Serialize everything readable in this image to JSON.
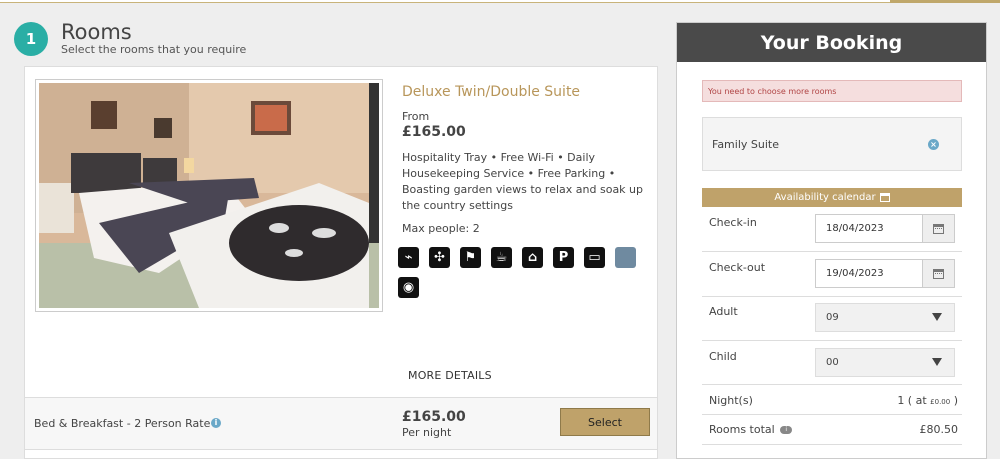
{
  "step": {
    "number": "1",
    "title": "Rooms",
    "subtitle": "Select the rooms that you require"
  },
  "room": {
    "name": "Deluxe Twin/Double Suite",
    "from_label": "From",
    "from_price": "£165.00",
    "amenities": "Hospitality Tray • Free Wi-Fi • Daily Housekeeping Service • Free Parking • Boasting garden views to relax and soak up the country settings",
    "max_people": "Max people: 2",
    "facility_icons": [
      {
        "name": "hairdryer-plug-icon",
        "glyph": "⌁"
      },
      {
        "name": "fan-icon",
        "glyph": "✣"
      },
      {
        "name": "hairdryer-icon",
        "glyph": "⚑"
      },
      {
        "name": "kettle-icon",
        "glyph": "☕"
      },
      {
        "name": "house-icon",
        "glyph": "⌂"
      },
      {
        "name": "parking-icon",
        "glyph": "P"
      },
      {
        "name": "tv-icon",
        "glyph": "▭"
      },
      {
        "name": "garden-view-icon",
        "glyph": ""
      },
      {
        "name": "wifi-icon",
        "glyph": "◉"
      }
    ],
    "more_details": "MORE DETAILS"
  },
  "rate": {
    "name": "Bed & Breakfast - 2 Person Rate",
    "price": "£165.00",
    "per": "Per night",
    "select_label": "Select"
  },
  "booking": {
    "title": "Your Booking",
    "warning": "You need to choose more rooms",
    "selected_room": "Family Suite",
    "availability_label": "Availability calendar",
    "checkin_label": "Check-in",
    "checkin_value": "18/04/2023",
    "checkout_label": "Check-out",
    "checkout_value": "19/04/2023",
    "adult_label": "Adult",
    "adult_value": "09",
    "child_label": "Child",
    "child_value": "00",
    "nights_label": "Night(s)",
    "nights_value": "1 ( at ",
    "nights_rate": "£0.00",
    "nights_close": " )",
    "rooms_total_label": "Rooms total",
    "rooms_total_value": "£80.50"
  },
  "colors": {
    "teal": "#2aaea5",
    "gold": "#bfa26a",
    "header_dark": "#4a4a4a",
    "warn_bg": "#f5dede"
  }
}
